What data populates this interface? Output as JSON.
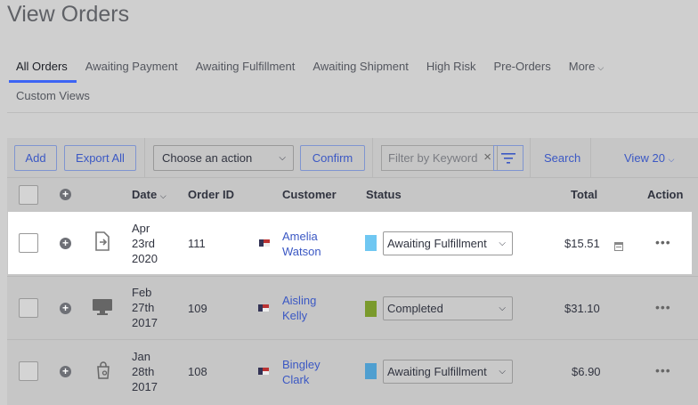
{
  "page": {
    "title": "View Orders"
  },
  "tabs": [
    {
      "label": "All Orders",
      "active": true
    },
    {
      "label": "Awaiting Payment"
    },
    {
      "label": "Awaiting Fulfillment"
    },
    {
      "label": "Awaiting Shipment"
    },
    {
      "label": "High Risk"
    },
    {
      "label": "Pre-Orders"
    },
    {
      "label": "More"
    },
    {
      "label": "Custom Views"
    }
  ],
  "toolbar": {
    "add_label": "Add",
    "export_label": "Export All",
    "action_select": "Choose an action",
    "confirm_label": "Confirm",
    "filter_placeholder": "Filter by Keyword",
    "search_label": "Search",
    "view_label": "View 20"
  },
  "columns": {
    "date": "Date",
    "order_id": "Order ID",
    "customer": "Customer",
    "status": "Status",
    "total": "Total",
    "action": "Action"
  },
  "orders": [
    {
      "date": [
        "Apr",
        "23rd",
        "2020"
      ],
      "order_id": "111",
      "customer": [
        "Amelia",
        "Watson"
      ],
      "status": "Awaiting Fulfillment",
      "status_color": "#6fc7f2",
      "total": "$15.51",
      "source_icon": "manual-order-icon"
    },
    {
      "date": [
        "Feb",
        "27th",
        "2017"
      ],
      "order_id": "109",
      "customer": [
        "Aisling",
        "Kelly"
      ],
      "status": "Completed",
      "status_color": "#7a9a2c",
      "total": "$31.10",
      "source_icon": "desktop-icon"
    },
    {
      "date": [
        "Jan",
        "28th",
        "2017"
      ],
      "order_id": "108",
      "customer": [
        "Bingley",
        "Clark"
      ],
      "status": "Awaiting Fulfillment",
      "status_color": "#4f9fd0",
      "total": "$6.90",
      "source_icon": "shopping-bag-icon"
    }
  ]
}
